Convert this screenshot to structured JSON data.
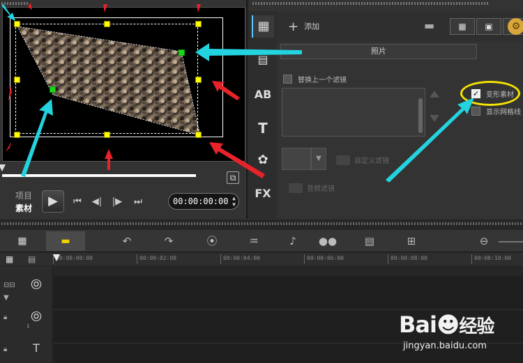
{
  "preview": {
    "mode_project": "项目",
    "mode_clip": "素材",
    "timecode": "00:00:00:00",
    "play_icon": "▶",
    "transport": [
      "⏮",
      "◀|",
      "|▶",
      "⏭"
    ]
  },
  "options": {
    "add_label": "添加",
    "photo_tab": "照片",
    "replace_filter_label": "替换上一个滤镜",
    "deform_clip_label": "变形素材",
    "show_grid_label": "显示网格线",
    "custom_filter_label": "自定义滤镜",
    "audio_filter_label": "音频滤镜",
    "side_tabs": [
      "media-icon",
      "instant-project-icon",
      "title-icon",
      "text-icon",
      "graphic-icon",
      "fx-icon"
    ],
    "side_tab_text": {
      "title": "AB",
      "text": "T",
      "fx": "FX"
    }
  },
  "timeline": {
    "add_remove": "+/- ▾",
    "ruler_ticks": [
      "00:00:00:00",
      "00:00:02:00",
      "00:00:04:00",
      "00:00:06:00",
      "00:00:08:00",
      "00:00:10:00"
    ],
    "track_numbers": [
      "1"
    ]
  },
  "watermark": {
    "logo_latin": "Bai",
    "logo_zh": "经验",
    "url": "jingyan.baidu.com"
  },
  "colors": {
    "handle_yellow": "#ffff00",
    "handle_green": "#1ed41e",
    "arrow_cyan": "#23d3df",
    "arrow_red": "#e8232a",
    "highlight_yellow": "#f5e400"
  }
}
